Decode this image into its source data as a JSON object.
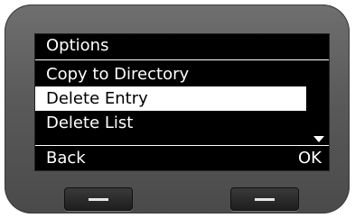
{
  "screen": {
    "title": "Options",
    "menu": [
      {
        "label": "Copy to Directory",
        "selected": false
      },
      {
        "label": "Delete Entry",
        "selected": true
      },
      {
        "label": "Delete List",
        "selected": false
      }
    ],
    "softkeys": {
      "left": "Back",
      "right": "OK"
    }
  },
  "icons": {
    "scroll": "scroll-down-arrow-icon"
  },
  "colors": {
    "screen_background": "#000000",
    "text": "#ffffff",
    "selected_background": "#ffffff",
    "selected_text": "#000000",
    "device_body": "#5a5a5a"
  }
}
